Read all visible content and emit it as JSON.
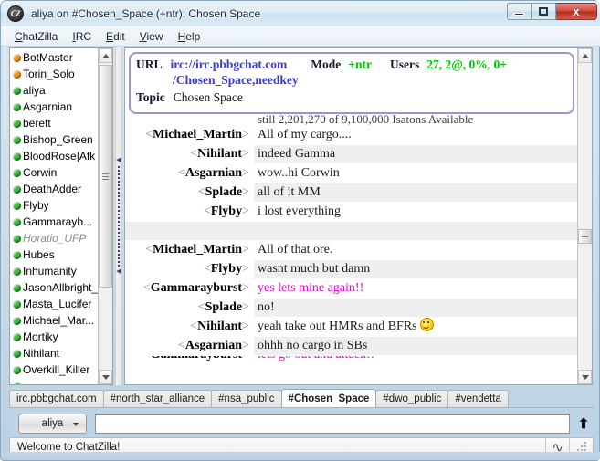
{
  "window": {
    "title": "aliya on #Chosen_Space (+ntr): Chosen Space",
    "app_icon": "chatzilla-icon",
    "icon_text": "CZ",
    "controls": {
      "minimize": "minimize-icon",
      "maximize": "maximize-icon",
      "close_label": "x"
    }
  },
  "menubar": {
    "items": [
      {
        "label": "ChatZilla",
        "accesskey": "C"
      },
      {
        "label": "IRC",
        "accesskey": "I"
      },
      {
        "label": "Edit",
        "accesskey": "E"
      },
      {
        "label": "View",
        "accesskey": "V"
      },
      {
        "label": "Help",
        "accesskey": "H"
      }
    ]
  },
  "userlist": {
    "users": [
      {
        "nick": "BotMaster",
        "status": "op",
        "away": false
      },
      {
        "nick": "Torin_Solo",
        "status": "op",
        "away": false
      },
      {
        "nick": "aliya",
        "status": "voice",
        "away": false
      },
      {
        "nick": "Asgarnian",
        "status": "voice",
        "away": false
      },
      {
        "nick": "bereft",
        "status": "voice",
        "away": false
      },
      {
        "nick": "Bishop_Green",
        "status": "voice",
        "away": false
      },
      {
        "nick": "BloodRose|Afk",
        "status": "voice",
        "away": false
      },
      {
        "nick": "Corwin",
        "status": "voice",
        "away": false
      },
      {
        "nick": "DeathAdder",
        "status": "voice",
        "away": false
      },
      {
        "nick": "Flyby",
        "status": "voice",
        "away": false
      },
      {
        "nick": "Gammarayb...",
        "status": "voice",
        "away": false
      },
      {
        "nick": "Horatio_UFP",
        "status": "voice",
        "away": true
      },
      {
        "nick": "Hubes",
        "status": "voice",
        "away": false
      },
      {
        "nick": "Inhumanity",
        "status": "voice",
        "away": false
      },
      {
        "nick": "JasonAllbright_",
        "status": "voice",
        "away": false
      },
      {
        "nick": "Masta_Lucifer",
        "status": "voice",
        "away": false
      },
      {
        "nick": "Michael_Mar...",
        "status": "voice",
        "away": false
      },
      {
        "nick": "Mortiky",
        "status": "voice",
        "away": false
      },
      {
        "nick": "Nihilant",
        "status": "voice",
        "away": false
      },
      {
        "nick": "Overkill_Killer",
        "status": "voice",
        "away": false
      },
      {
        "nick": "",
        "status": "voice",
        "away": false
      }
    ]
  },
  "header": {
    "url_label": "URL",
    "url_line1": "irc://irc.pbbgchat.com",
    "url_line2": "/Chosen_Space,needkey",
    "mode_label": "Mode",
    "mode_value": "+ntr",
    "users_label": "Users",
    "users_value": "27, 2@, 0%, 0+",
    "topic_label": "Topic",
    "topic_value": "Chosen Space"
  },
  "messages": [
    {
      "nick": "",
      "body": "still 2,201,270 of 9,100,000 Isatons Available",
      "color": "normal",
      "alt": false,
      "partial": "top",
      "smiley": false
    },
    {
      "nick": "Michael_Martin",
      "body": "All of my cargo....",
      "color": "normal",
      "alt": false,
      "partial": "",
      "smiley": false
    },
    {
      "nick": "Nihilant",
      "body": "indeed Gamma",
      "color": "normal",
      "alt": true,
      "partial": "",
      "smiley": false
    },
    {
      "nick": "Asgarnian",
      "body": "wow..hi Corwin",
      "color": "normal",
      "alt": false,
      "partial": "",
      "smiley": false
    },
    {
      "nick": "Splade",
      "body": "all of it MM",
      "color": "normal",
      "alt": true,
      "partial": "",
      "smiley": false
    },
    {
      "nick": "Flyby",
      "body": "i lost everything",
      "color": "normal",
      "alt": false,
      "partial": "",
      "smiley": false
    },
    {
      "nick": "",
      "body": "",
      "color": "normal",
      "alt": true,
      "partial": "",
      "smiley": false
    },
    {
      "nick": "Michael_Martin",
      "body": "All of that ore.",
      "color": "normal",
      "alt": false,
      "partial": "",
      "smiley": false
    },
    {
      "nick": "Flyby",
      "body": "wasnt much but damn",
      "color": "normal",
      "alt": true,
      "partial": "",
      "smiley": false
    },
    {
      "nick": "Gammarayburst",
      "body": "yes lets mine again!!",
      "color": "magenta",
      "alt": false,
      "partial": "",
      "smiley": false
    },
    {
      "nick": "Splade",
      "body": "no!",
      "color": "normal",
      "alt": true,
      "partial": "",
      "smiley": false
    },
    {
      "nick": "Nihilant",
      "body": "yeah take out HMRs and BFRs",
      "color": "normal",
      "alt": false,
      "partial": "",
      "smiley": true
    },
    {
      "nick": "Asgarnian",
      "body": "ohhh no cargo in SBs",
      "color": "normal",
      "alt": true,
      "partial": "",
      "smiley": false
    },
    {
      "nick": "Gammarayburst",
      "body": "lets go out and attack!!",
      "color": "magenta",
      "alt": false,
      "partial": "bottom",
      "smiley": false
    }
  ],
  "tabs": [
    {
      "label": "irc.pbbgchat.com",
      "active": false
    },
    {
      "label": "#north_star_alliance",
      "active": false
    },
    {
      "label": "#nsa_public",
      "active": false
    },
    {
      "label": "#Chosen_Space",
      "active": true
    },
    {
      "label": "#dwo_public",
      "active": false
    },
    {
      "label": "#vendetta",
      "active": false
    }
  ],
  "input": {
    "nick_button": "aliya",
    "value": "",
    "placeholder": "",
    "send_icon": "up-arrow-icon"
  },
  "statusbar": {
    "text": "Welcome to ChatZilla!",
    "security_icon": "squiggle-icon",
    "resize_grip": "resize-grip-icon"
  },
  "colors": {
    "accent_green": "#00c400",
    "link_blue": "#3b3bcd",
    "magenta": "#f000cc",
    "header_border": "#9a97c8",
    "op_bullet": "#e87d09",
    "voice_bullet": "#18a018"
  }
}
